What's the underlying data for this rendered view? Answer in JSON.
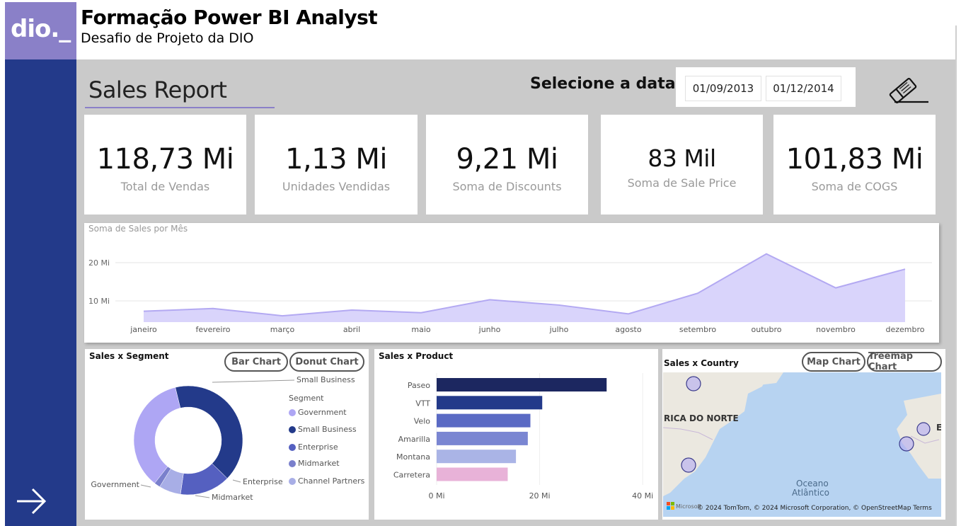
{
  "header": {
    "logo_text": "dio._",
    "title": "Formação Power BI Analyst",
    "subtitle": "Desafio de Projeto da DIO"
  },
  "sidebar": {
    "next_icon": "arrow-right-icon"
  },
  "report": {
    "title": "Sales Report",
    "date_label": "Selecione a data",
    "date_start": "01/09/2013",
    "date_end": "01/12/2014",
    "clear_icon": "eraser-icon"
  },
  "kpis": [
    {
      "value": "118,73 Mi",
      "label": "Total de Vendas"
    },
    {
      "value": "1,13 Mi",
      "label": "Unidades Vendidas"
    },
    {
      "value": "9,21 Mi",
      "label": "Soma de Discounts"
    },
    {
      "value": "83 Mil",
      "label": "Soma de Sale Price"
    },
    {
      "value": "101,83 Mi",
      "label": "Soma de COGS"
    }
  ],
  "colors": {
    "sidebar": "#233a8a",
    "logo_bg": "#8a80c8",
    "canvas_bg": "#cacaca",
    "area_fill": "#d9d4fb",
    "area_line": "#b3a9f2",
    "government": "#aea6f4",
    "small_business": "#233a8a",
    "enterprise": "#5560c0",
    "midmarket": "#7a80cc",
    "channel_partners": "#a8aee6"
  },
  "line_chart": {
    "title": "Soma de  Sales por Mês",
    "chart_data": {
      "type": "area",
      "title": "Soma de  Sales por Mês",
      "x": [
        "janeiro",
        "fevereiro",
        "março",
        "abril",
        "maio",
        "junho",
        "julho",
        "agosto",
        "setembro",
        "outubro",
        "novembro",
        "dezembro"
      ],
      "y_ticks": [
        "10 Mi",
        "20 Mi"
      ],
      "values": [
        7.3,
        8.0,
        6.1,
        7.6,
        6.9,
        10.3,
        8.9,
        6.6,
        12.0,
        22.3,
        13.4,
        18.3
      ],
      "ylim": [
        0,
        25
      ],
      "unit": "Mi",
      "grid": true
    }
  },
  "segment_chart": {
    "title": "Sales x Segment",
    "buttons": [
      "Bar Chart",
      "Donut Chart"
    ],
    "legend_title": "Segment",
    "chart_data": {
      "type": "pie",
      "donut": true,
      "categories": [
        "Government",
        "Small Business",
        "Enterprise",
        "Midmarket",
        "Channel Partners"
      ],
      "values": [
        35.6,
        41.1,
        15.0,
        1.8,
        6.5
      ],
      "legend": "right"
    },
    "slice_labels": {
      "small_business": "Small Business",
      "enterprise": "Enterprise",
      "midmarket": "Midmarket",
      "government": "Government"
    }
  },
  "product_chart": {
    "title": "Sales x Product",
    "chart_data": {
      "type": "bar",
      "orientation": "horizontal",
      "categories": [
        "Paseo",
        "VTT",
        "Velo",
        "Amarilla",
        "Montana",
        "Carretera"
      ],
      "values": [
        33.0,
        20.5,
        18.2,
        17.7,
        15.4,
        13.8
      ],
      "x_ticks": [
        "0 Mi",
        "20 Mi",
        "40 Mi"
      ],
      "xlim": [
        0,
        40
      ],
      "colors": [
        "#1c2760",
        "#233a8a",
        "#5a6ac4",
        "#7a86d2",
        "#aab4e6",
        "#e8b2d8"
      ]
    }
  },
  "country_chart": {
    "title": "Sales x Country",
    "buttons": [
      "Map Chart",
      "Treemap Chart"
    ],
    "map_labels": [
      "RICA DO NORTE",
      "E",
      "Oceano",
      "Atlântico"
    ],
    "attribution": "© 2024 TomTom, © 2024 Microsoft Corporation, © OpenStreetMap  Terms",
    "ms_logo_label": "Microsoft"
  }
}
